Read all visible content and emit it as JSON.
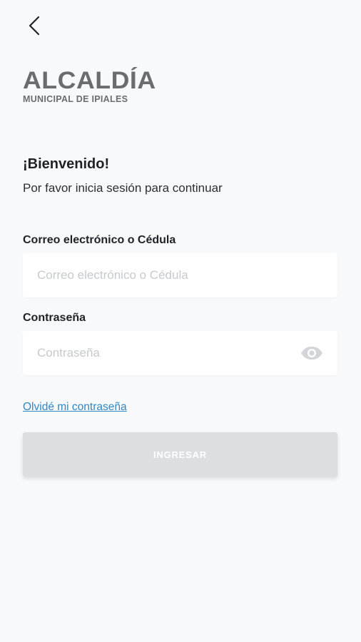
{
  "header": {
    "back_icon": "chevron-left-icon"
  },
  "logo": {
    "main": "ALCALDÍA",
    "sub": "MUNICIPAL DE IPIALES"
  },
  "welcome": {
    "title": "¡Bienvenido!",
    "subtitle": "Por favor inicia sesión para continuar"
  },
  "form": {
    "email_label": "Correo electrónico o Cédula",
    "email_placeholder": "Correo electrónico o Cédula",
    "email_value": "",
    "password_label": "Contraseña",
    "password_placeholder": "Contraseña",
    "password_value": "",
    "password_toggle_icon": "eye-icon",
    "forgot_link": "Olvidé mi contraseña",
    "submit_label": "INGRESAR"
  },
  "colors": {
    "background": "#f8f9fa",
    "link": "#2f87c7",
    "button_disabled": "#dcdee0",
    "logo": "#6a6d70"
  }
}
